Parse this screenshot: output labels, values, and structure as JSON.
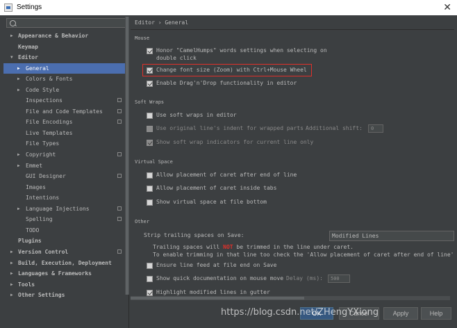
{
  "window": {
    "title": "Settings",
    "close_glyph": "✕"
  },
  "sidebar": {
    "search_placeholder": "",
    "items": [
      {
        "label": "Appearance & Behavior",
        "arrow": "▶"
      },
      {
        "label": "Keymap"
      },
      {
        "label": "Editor",
        "arrow": "▼"
      },
      {
        "label": "General",
        "arrow": "▶"
      },
      {
        "label": "Colors & Fonts",
        "arrow": "▶"
      },
      {
        "label": "Code Style",
        "arrow": "▶"
      },
      {
        "label": "Inspections"
      },
      {
        "label": "File and Code Templates"
      },
      {
        "label": "File Encodings"
      },
      {
        "label": "Live Templates"
      },
      {
        "label": "File Types"
      },
      {
        "label": "Copyright",
        "arrow": "▶"
      },
      {
        "label": "Emmet",
        "arrow": "▶"
      },
      {
        "label": "GUI Designer"
      },
      {
        "label": "Images"
      },
      {
        "label": "Intentions"
      },
      {
        "label": "Language Injections",
        "arrow": "▶"
      },
      {
        "label": "Spelling"
      },
      {
        "label": "TODO"
      },
      {
        "label": "Plugins"
      },
      {
        "label": "Version Control",
        "arrow": "▶"
      },
      {
        "label": "Build, Execution, Deployment",
        "arrow": "▶"
      },
      {
        "label": "Languages & Frameworks",
        "arrow": "▶"
      },
      {
        "label": "Tools",
        "arrow": "▶"
      },
      {
        "label": "Other Settings",
        "arrow": "▶"
      }
    ]
  },
  "main": {
    "breadcrumb": "Editor › General",
    "mouse": {
      "title": "Mouse",
      "camel_1": "Honor \"CamelHumps\" words settings when selecting on",
      "camel_2": "double click",
      "zoom": "Change font size (Zoom) with Ctrl+Mouse Wheel",
      "dnd": "Enable Drag'n'Drop functionality in editor"
    },
    "soft_wraps": {
      "title": "Soft Wraps",
      "use_soft_wraps": "Use soft wraps in editor",
      "original_indent": "Use original line's indent for wrapped parts",
      "additional_shift_label": "Additional shift:",
      "additional_shift_value": "0",
      "show_indicators": "Show soft wrap indicators for current line only"
    },
    "virtual_space": {
      "title": "Virtual Space",
      "after_end": "Allow placement of caret after end of line",
      "inside_tabs": "Allow placement of caret inside tabs",
      "at_bottom": "Show virtual space at file bottom"
    },
    "other": {
      "title": "Other",
      "strip_label": "Strip trailing spaces on Save:",
      "strip_value": "Modified Lines",
      "note1_a": "Trailing spaces will ",
      "note1_dont": "NOT",
      "note1_b": " be trimmed in the line under caret.",
      "note2": "To enable trimming in that line too check the 'Allow placement of caret after end of line' a",
      "ensure_feed": "Ensure line feed at file end on Save",
      "quick_doc": "Show quick documentation on mouse move",
      "delay_label": "Delay (ms):",
      "delay_value": "500",
      "highlight_modified": "Highlight modified lines in gutter"
    },
    "buttons": {
      "ok": "OK",
      "cancel": "Cancel",
      "apply": "Apply",
      "help": "Help"
    }
  },
  "watermark": "https://blog.csdn.net/ZHengYXiong"
}
